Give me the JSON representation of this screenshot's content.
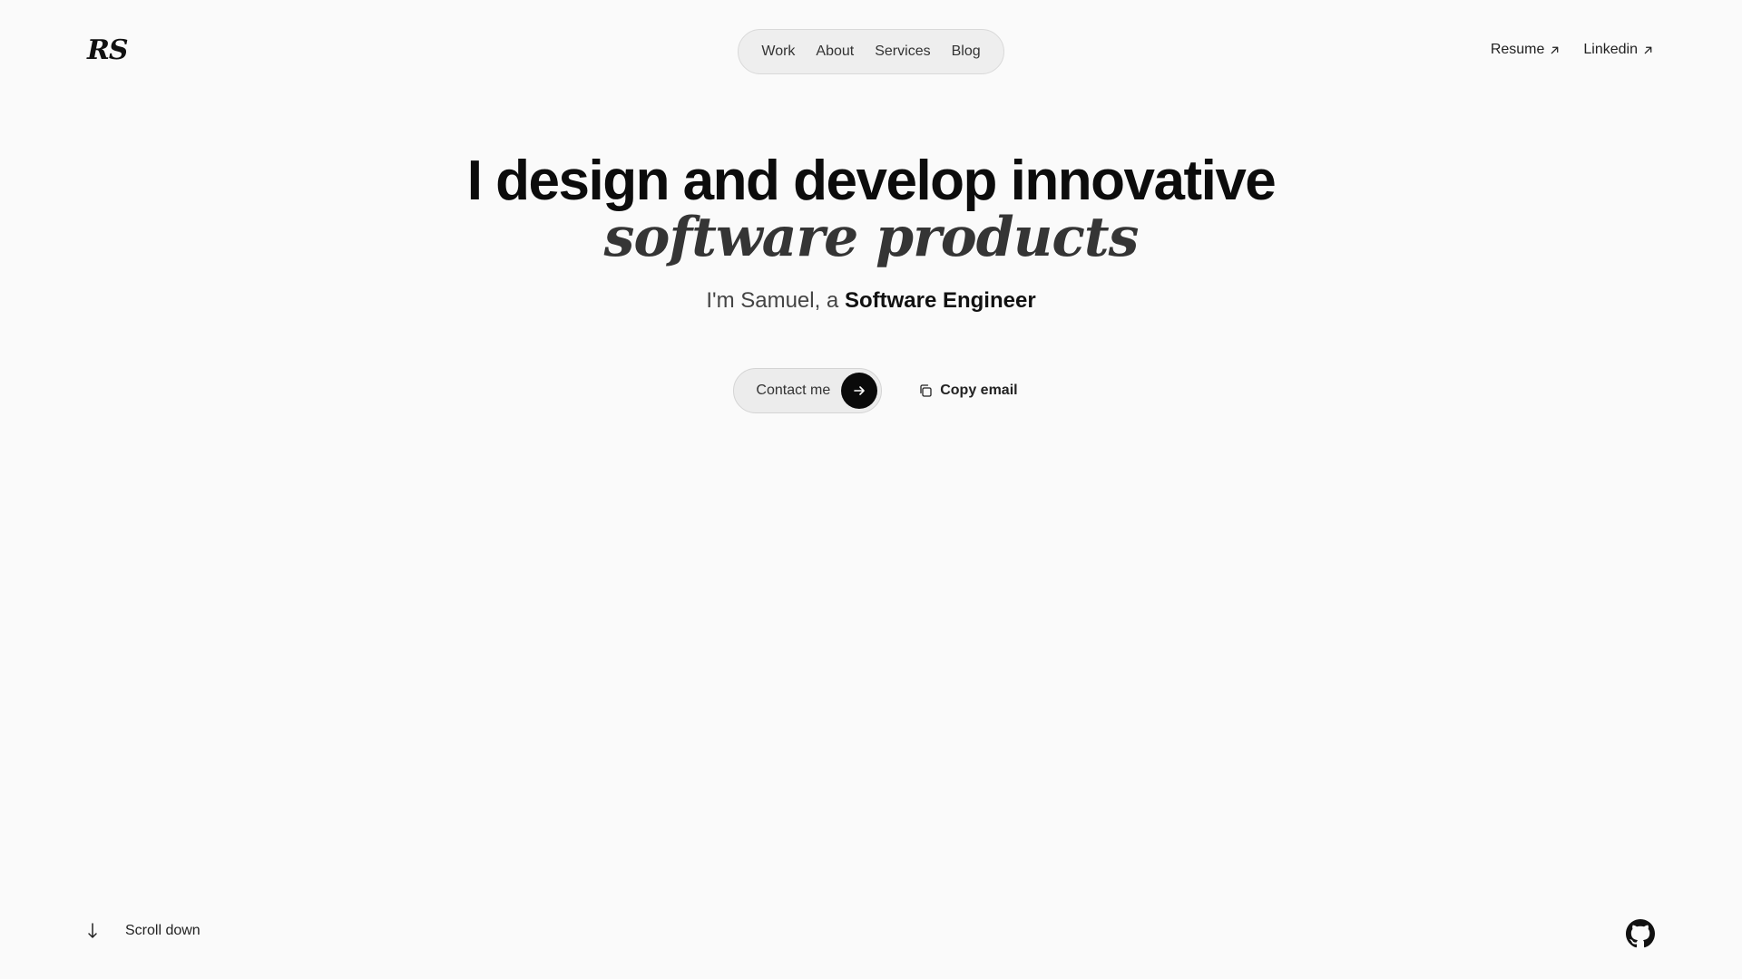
{
  "brand": {
    "logo_text": "RS"
  },
  "nav": {
    "items": [
      {
        "label": "Work"
      },
      {
        "label": "About"
      },
      {
        "label": "Services"
      },
      {
        "label": "Blog"
      }
    ]
  },
  "external_links": [
    {
      "label": "Resume",
      "icon": "arrow-up-right-icon"
    },
    {
      "label": "Linkedin",
      "icon": "arrow-up-right-icon"
    }
  ],
  "hero": {
    "headline_line1": "I design and develop innovative",
    "headline_line2": "software products",
    "intro_prefix": "I'm Samuel, a ",
    "intro_role": "Software Engineer"
  },
  "actions": {
    "contact_label": "Contact me",
    "contact_icon": "arrow-right-icon",
    "copy_label": "Copy email",
    "copy_icon": "copy-icon"
  },
  "footer": {
    "scroll_label": "Scroll down",
    "scroll_icon": "arrow-down-icon",
    "social_icon": "github-icon"
  },
  "colors": {
    "background": "#fafafa",
    "text": "#111111",
    "pill_bg": "#eeeeee",
    "accent": "#0a0a0a"
  }
}
